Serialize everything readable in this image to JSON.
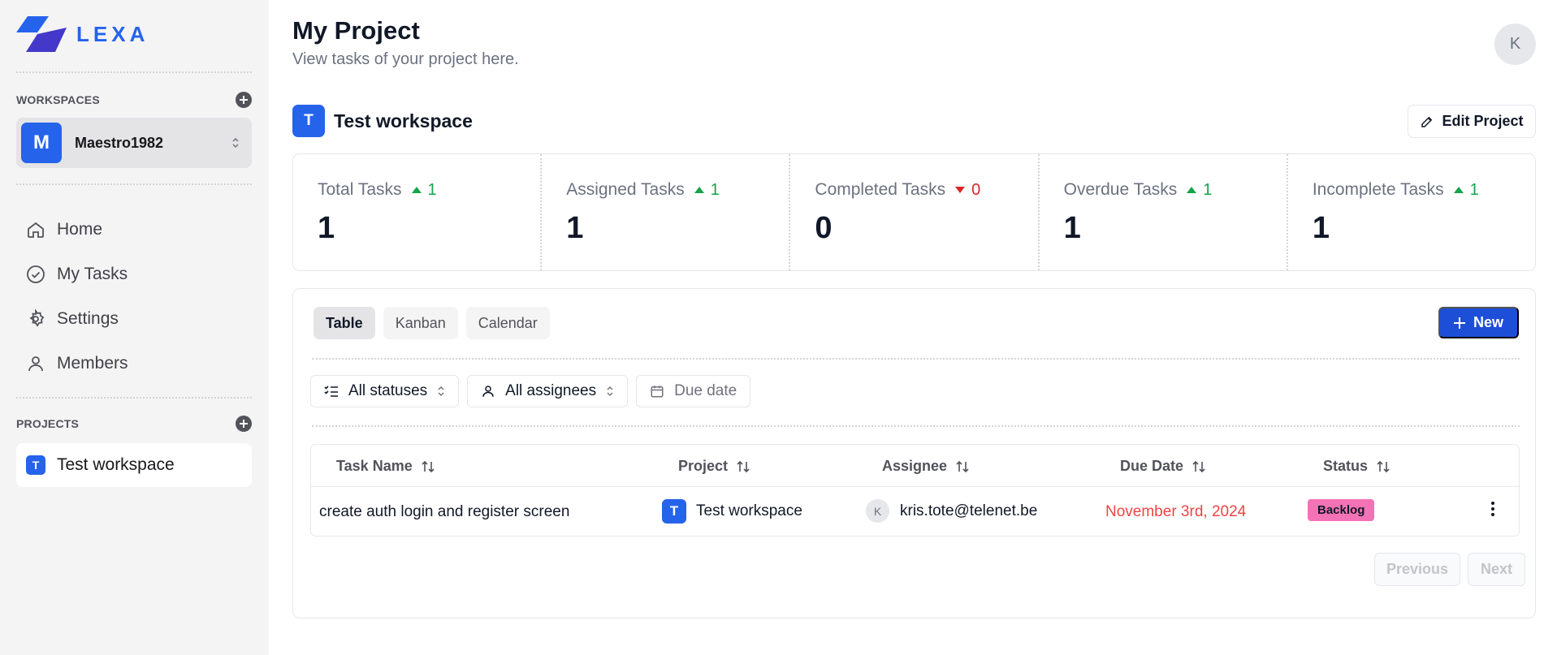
{
  "app": {
    "brand": "LEXA",
    "brand_color": "#2563eb"
  },
  "sidebar": {
    "workspaces_label": "WORKSPACES",
    "current_workspace": {
      "initial": "M",
      "name": "Maestro1982"
    },
    "nav": [
      {
        "label": "Home",
        "icon": "home-icon"
      },
      {
        "label": "My Tasks",
        "icon": "check-circle-icon"
      },
      {
        "label": "Settings",
        "icon": "gear-icon"
      },
      {
        "label": "Members",
        "icon": "user-icon"
      }
    ],
    "projects_label": "PROJECTS",
    "projects": [
      {
        "initial": "T",
        "name": "Test workspace"
      }
    ]
  },
  "header": {
    "title": "My Project",
    "subtitle": "View tasks of your project here.",
    "user_initial": "K"
  },
  "workspace": {
    "initial": "T",
    "name": "Test workspace",
    "edit_label": "Edit Project"
  },
  "stats": [
    {
      "label": "Total Tasks",
      "delta": "1",
      "trend": "up",
      "value": "1"
    },
    {
      "label": "Assigned Tasks",
      "delta": "1",
      "trend": "up",
      "value": "1"
    },
    {
      "label": "Completed Tasks",
      "delta": "0",
      "trend": "down",
      "value": "0"
    },
    {
      "label": "Overdue Tasks",
      "delta": "1",
      "trend": "up",
      "value": "1"
    },
    {
      "label": "Incomplete Tasks",
      "delta": "1",
      "trend": "up",
      "value": "1"
    }
  ],
  "views": {
    "tabs": [
      "Table",
      "Kanban",
      "Calendar"
    ],
    "active": "Table",
    "new_label": "New"
  },
  "filters": {
    "status": "All statuses",
    "assignee": "All assignees",
    "due_date": "Due date"
  },
  "table": {
    "columns": [
      "Task Name",
      "Project",
      "Assignee",
      "Due Date",
      "Status"
    ],
    "rows": [
      {
        "task": "create auth login and register screen",
        "project_initial": "T",
        "project": "Test workspace",
        "assignee_initial": "K",
        "assignee": "kris.tote@telenet.be",
        "due": "November 3rd, 2024",
        "status": "Backlog"
      }
    ]
  },
  "pagination": {
    "previous": "Previous",
    "next": "Next"
  },
  "colors": {
    "accent": "#2563eb",
    "up": "#16a34a",
    "down": "#dc2626",
    "overdue": "#ef4444",
    "backlog": "#f472b6"
  }
}
